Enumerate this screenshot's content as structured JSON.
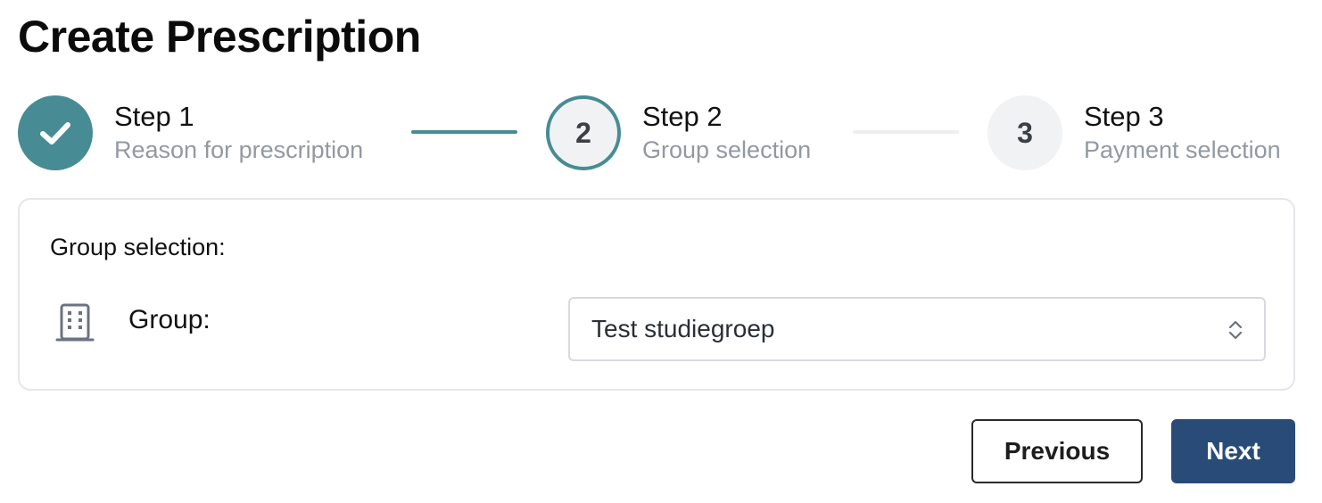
{
  "page": {
    "title": "Create Prescription"
  },
  "stepper": {
    "steps": [
      {
        "label": "Step 1",
        "description": "Reason for prescription",
        "state": "completed",
        "number": "1"
      },
      {
        "label": "Step 2",
        "description": "Group selection",
        "state": "current",
        "number": "2"
      },
      {
        "label": "Step 3",
        "description": "Payment selection",
        "state": "upcoming",
        "number": "3"
      }
    ]
  },
  "group_card": {
    "heading": "Group selection:",
    "field_label": "Group:",
    "selected_value": "Test studiegroep",
    "icon": "building-icon"
  },
  "actions": {
    "previous_label": "Previous",
    "next_label": "Next"
  },
  "colors": {
    "accent": "#478c94",
    "primary_button": "#284b78",
    "muted_text": "#9299a3",
    "border": "#e4e6ea"
  }
}
